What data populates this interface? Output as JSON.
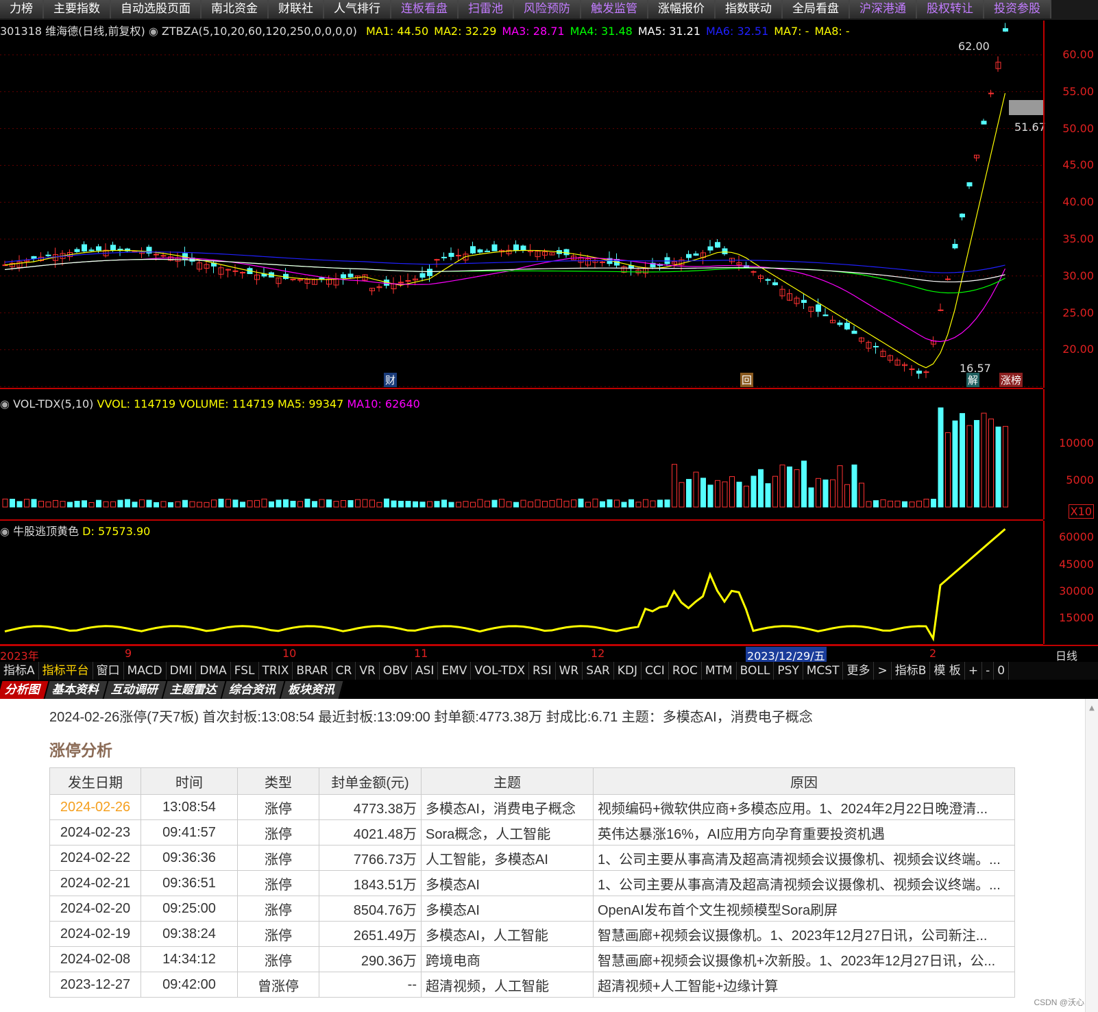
{
  "top_tabs": [
    {
      "label": "力榜",
      "purple": false
    },
    {
      "label": "主要指数",
      "purple": false
    },
    {
      "label": "自动选股页面",
      "purple": false
    },
    {
      "label": "南北资金",
      "purple": false
    },
    {
      "label": "财联社",
      "purple": false
    },
    {
      "label": "人气排行",
      "purple": false
    },
    {
      "label": "连板看盘",
      "purple": true
    },
    {
      "label": "扫雷池",
      "purple": true
    },
    {
      "label": "风险预防",
      "purple": true
    },
    {
      "label": "触发监管",
      "purple": true
    },
    {
      "label": "涨幅报价",
      "purple": false
    },
    {
      "label": "指数联动",
      "purple": false
    },
    {
      "label": "全局看盘",
      "purple": false
    },
    {
      "label": "沪深港通",
      "purple": true
    },
    {
      "label": "股权转让",
      "purple": true
    },
    {
      "label": "投资参股",
      "purple": true
    }
  ],
  "kline_header": {
    "stock": "301318 维海德(日线,前复权)",
    "indicator": "ZTBZA(5,10,20,60,120,250,0,0,0,0)",
    "ma": [
      {
        "text": "MA1: 44.50",
        "color": "#ffff00"
      },
      {
        "text": "MA2: 32.29",
        "color": "#ffff00"
      },
      {
        "text": "MA3: 28.71",
        "color": "#ff00ff"
      },
      {
        "text": "MA4: 31.48",
        "color": "#00ff00"
      },
      {
        "text": "MA5: 31.21",
        "color": "#ffffff"
      },
      {
        "text": "MA6: 32.51",
        "color": "#2020ff"
      },
      {
        "text": "MA7: -",
        "color": "#ffff00"
      },
      {
        "text": "MA8: -",
        "color": "#ffff00"
      }
    ]
  },
  "price_axis": [
    "60.00",
    "55.00",
    "50.00",
    "45.00",
    "40.00",
    "35.00",
    "30.00",
    "25.00",
    "20.00"
  ],
  "price_annotations": {
    "high": "62.00",
    "mid": "51.67",
    "low": "16.57"
  },
  "event_markers": [
    {
      "text": "财"
    },
    {
      "text": "回"
    },
    {
      "text": "解"
    },
    {
      "text": "涨榜"
    }
  ],
  "vol_header": {
    "title": "VOL-TDX(5,10)",
    "vvol": "VVOL: 114719",
    "volume": "VOLUME: 114719",
    "ma5": "MA5: 99347",
    "ma10": "MA10: 62640"
  },
  "vol_axis": [
    "10000",
    "5000"
  ],
  "vol_unit": "X10",
  "ind_header": {
    "title": "牛股逃顶黄色",
    "value": "D: 57573.90"
  },
  "ind_axis": [
    "60000",
    "45000",
    "30000",
    "15000"
  ],
  "date_axis": {
    "labels": [
      "2023年",
      "9",
      "10",
      "11",
      "12",
      "2023/12/29/五",
      "2"
    ],
    "right": "日线"
  },
  "indicator_tabs": [
    "指标A",
    "指标平台",
    "窗口",
    "MACD",
    "DMI",
    "DMA",
    "FSL",
    "TRIX",
    "BRAR",
    "CR",
    "VR",
    "OBV",
    "ASI",
    "EMV",
    "VOL-TDX",
    "RSI",
    "WR",
    "SAR",
    "KDJ",
    "CCI",
    "ROC",
    "MTM",
    "BOLL",
    "PSY",
    "MCST",
    "更多",
    ">",
    "指标B",
    "模 板",
    "+",
    "-",
    "0"
  ],
  "bottom_tabs": [
    "分析图",
    "基本资料",
    "互动调研",
    "主题雷达",
    "综合资讯",
    "板块资讯"
  ],
  "summary": "2024-02-26涨停(7天7板)  首次封板:13:08:54  最近封板:13:09:00  封单额:4773.38万  封成比:6.71  主题：多模态AI，消费电子概念",
  "section_title": "涨停分析",
  "table": {
    "headers": [
      "发生日期",
      "时间",
      "类型",
      "封单金额(元)",
      "主题",
      "原因"
    ],
    "rows": [
      [
        "2024-02-26",
        "13:08:54",
        "涨停",
        "4773.38万",
        "多模态AI，消费电子概念",
        "视频编码+微软供应商+多模态应用。1、2024年2月22日晚澄清..."
      ],
      [
        "2024-02-23",
        "09:41:57",
        "涨停",
        "4021.48万",
        "Sora概念，人工智能",
        "英伟达暴涨16%，AI应用方向孕育重要投资机遇"
      ],
      [
        "2024-02-22",
        "09:36:36",
        "涨停",
        "7766.73万",
        "人工智能，多模态AI",
        "1、公司主要从事高清及超高清视频会议摄像机、视频会议终端。..."
      ],
      [
        "2024-02-21",
        "09:36:51",
        "涨停",
        "1843.51万",
        "多模态AI",
        "1、公司主要从事高清及超高清视频会议摄像机、视频会议终端。..."
      ],
      [
        "2024-02-20",
        "09:25:00",
        "涨停",
        "8504.76万",
        "多模态AI",
        "OpenAI发布首个文生视频模型Sora刷屏"
      ],
      [
        "2024-02-19",
        "09:38:24",
        "涨停",
        "2651.49万",
        "多模态AI，人工智能",
        "智慧画廊+视频会议摄像机。1、2023年12月27日讯，公司新注..."
      ],
      [
        "2024-02-08",
        "14:34:12",
        "涨停",
        "290.36万",
        "跨境电商",
        "智慧画廊+视频会议摄像机+次新股。1、2023年12月27日讯，公..."
      ],
      [
        "2023-12-27",
        "09:42:00",
        "曾涨停",
        "--",
        "超清视频，人工智能",
        "超清视频+人工智能+边缘计算"
      ]
    ],
    "highlight_color": "#f5a020"
  },
  "watermark": "CSDN @沃心"
}
